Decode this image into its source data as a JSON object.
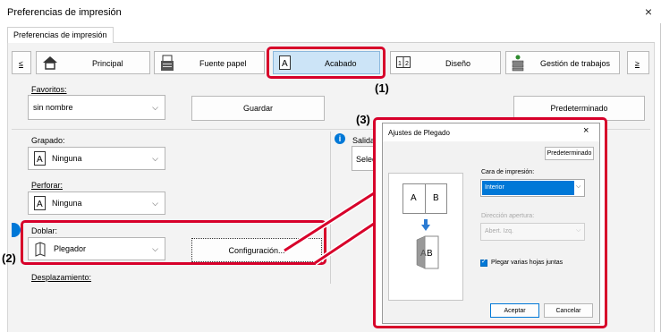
{
  "window": {
    "title": "Preferencias de impresión",
    "close_icon": "×"
  },
  "tabs": [
    {
      "label": "Preferencias de impresión"
    }
  ],
  "nav": {
    "prev": "≤",
    "next": "≥",
    "items": [
      {
        "label": "Principal"
      },
      {
        "label": "Fuente papel"
      },
      {
        "label": "Acabado"
      },
      {
        "label": "Diseño"
      },
      {
        "label": "Gestión de trabajos"
      }
    ]
  },
  "favorites": {
    "label": "Favoritos:",
    "value": "sin nombre",
    "save": "Guardar",
    "default": "Predeterminado"
  },
  "staple": {
    "label": "Grapado:",
    "value": "Ninguna",
    "icon_letter": "A"
  },
  "punch": {
    "label": "Perforar:",
    "value": "Ninguna",
    "icon_letter": "A"
  },
  "fold": {
    "label": "Doblar:",
    "value": "Plegador",
    "config": "Configuración..."
  },
  "offset": {
    "label": "Desplazamiento:"
  },
  "output": {
    "label": "Salida",
    "value": "Selec"
  },
  "annotations": {
    "one": "(1)",
    "two": "(2)",
    "three": "(3)"
  },
  "dialog": {
    "title": "Ajustes de Plegado",
    "close_icon": "×",
    "default": "Predeterminado",
    "print_side_label": "Cara de impresión:",
    "print_side_value": "Interior",
    "opening_label": "Dirección apertura:",
    "opening_value": "Abert. Izq.",
    "multi_label": "Plegar varias hojas juntas",
    "preview_a": "A",
    "preview_b": "B",
    "ok": "Aceptar",
    "cancel": "Cancelar"
  },
  "colors": {
    "accent": "#0078d7",
    "highlight": "#d7002a",
    "selected_tab": "#cce4f7"
  }
}
